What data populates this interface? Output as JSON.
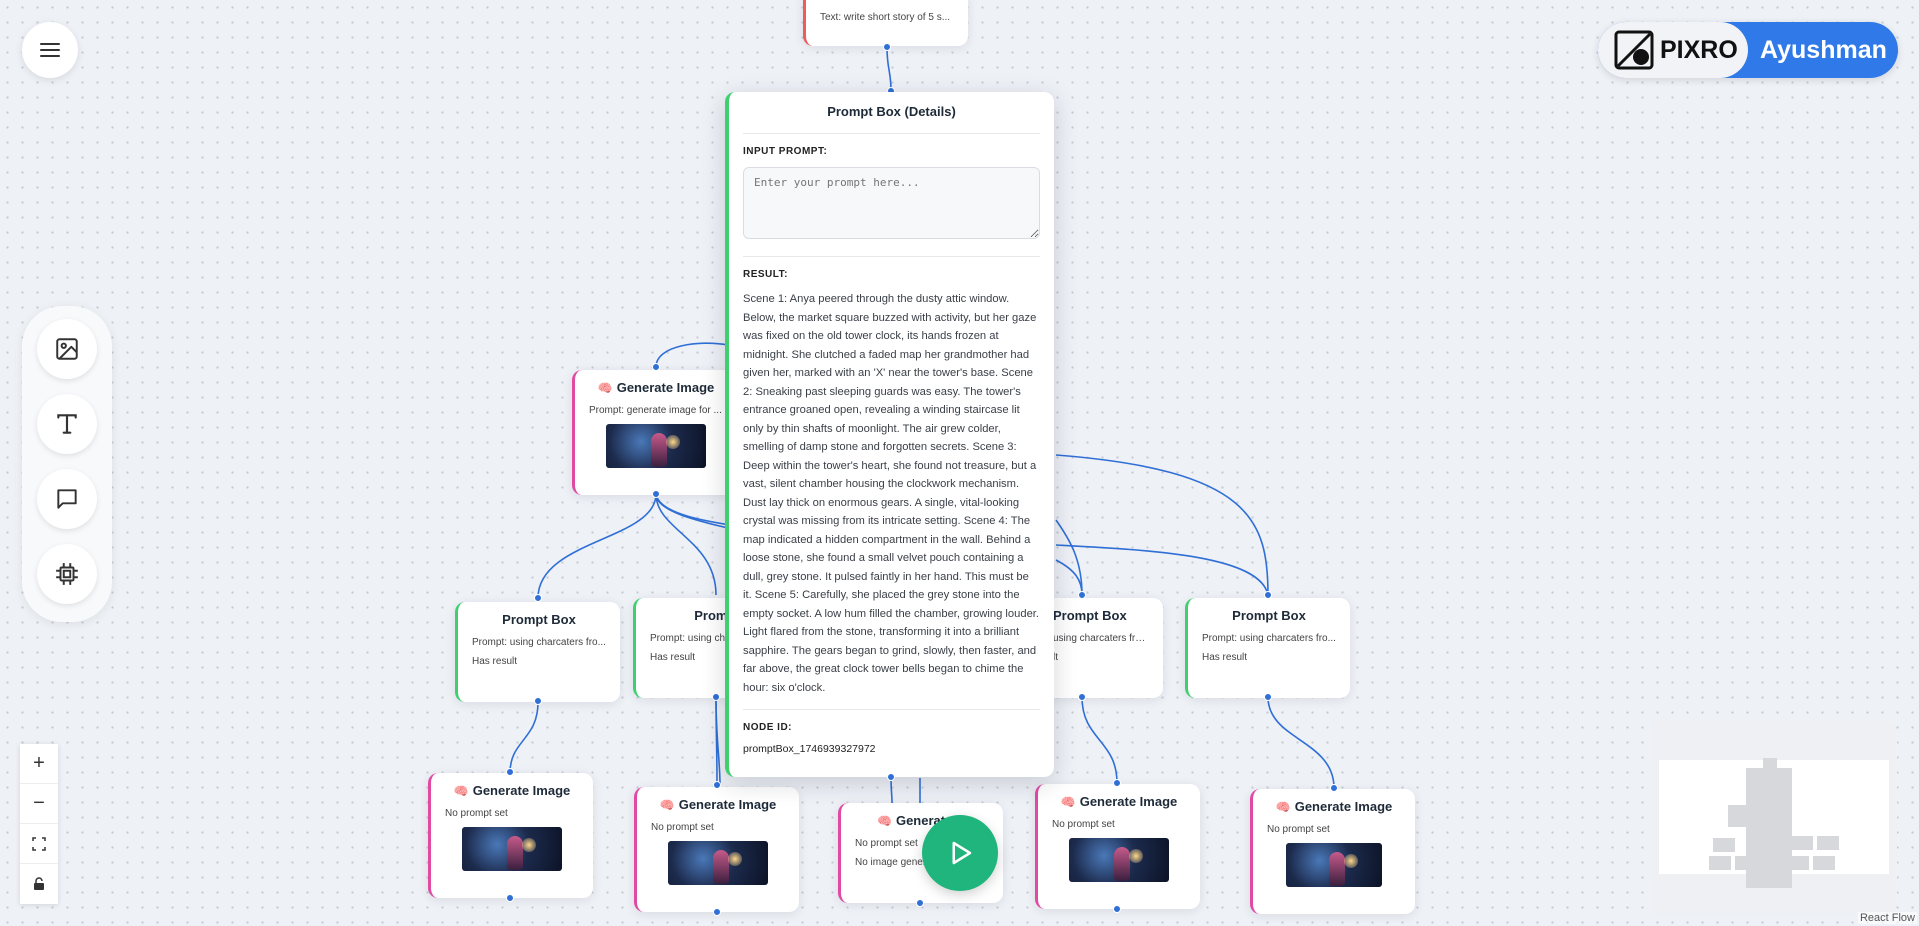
{
  "colors": {
    "accent": "#2f7ae8",
    "edge": "#2f6fd6",
    "prompt_border": "#3fcf6f",
    "image_border": "#e04aa3",
    "play": "#1fb57c"
  },
  "top_node": {
    "text": "Text: write short story of 5 s..."
  },
  "details": {
    "title": "Prompt Box (Details)",
    "input_label": "INPUT PROMPT:",
    "input_placeholder": "Enter your prompt here...",
    "result_label": "RESULT:",
    "result": "Scene 1: Anya peered through the dusty attic window. Below, the market square buzzed with activity, but her gaze was fixed on the old tower clock, its hands frozen at midnight. She clutched a faded map her grandmother had given her, marked with an 'X' near the tower's base. Scene 2: Sneaking past sleeping guards was easy. The tower's entrance groaned open, revealing a winding staircase lit only by thin shafts of moonlight. The air grew colder, smelling of damp stone and forgotten secrets. Scene 3: Deep within the tower's heart, she found not treasure, but a vast, silent chamber housing the clockwork mechanism. Dust lay thick on enormous gears. A single, vital-looking crystal was missing from its intricate setting. Scene 4: The map indicated a hidden compartment in the wall. Behind a loose stone, she found a small velvet pouch containing a dull, grey stone. It pulsed faintly in her hand. This must be it. Scene 5: Carefully, she placed the grey stone into the empty socket. A low hum filled the chamber, growing louder. Light flared from the stone, transforming it into a brilliant sapphire. The gears began to grind, slowly, then faster, and far above, the great clock tower bells began to chime the hour: six o'clock.",
    "node_id_label": "NODE ID:",
    "node_id": "promptBox_1746939327972"
  },
  "gen_top": {
    "title": "Generate Image",
    "prompt": "Prompt: generate image for ..."
  },
  "prompt_nodes": [
    {
      "title": "Prompt Box",
      "prompt": "Prompt: using charcaters fro...",
      "status": "Has result"
    },
    {
      "title": "Prompt",
      "prompt": "Prompt: using ch",
      "status": "Has result"
    },
    {
      "title": "Prompt Box",
      "prompt": "using charcaters fro...",
      "status": "lt"
    },
    {
      "title": "Prompt Box",
      "prompt": "Prompt: using charcaters fro...",
      "status": "Has result"
    }
  ],
  "gen_nodes": [
    {
      "title": "Generate Image",
      "prompt": "No prompt set"
    },
    {
      "title": "Generate Image",
      "prompt": "No prompt set"
    },
    {
      "title": "Generat",
      "prompt": "No prompt set",
      "extra": "No image genera"
    },
    {
      "title": "Generate Image",
      "prompt": "No prompt set"
    },
    {
      "title": "Generate Image",
      "prompt": "No prompt set"
    }
  ],
  "brand": {
    "logo": "PIXRO",
    "user": "Ayushman"
  },
  "attribution": "React Flow",
  "icons": [
    "menu-icon",
    "image-icon",
    "text-icon",
    "comment-icon",
    "chip-icon",
    "plus-icon",
    "minus-icon",
    "fit-view-icon",
    "lock-icon",
    "play-icon",
    "brain-icon",
    "pixro-logo-icon"
  ]
}
